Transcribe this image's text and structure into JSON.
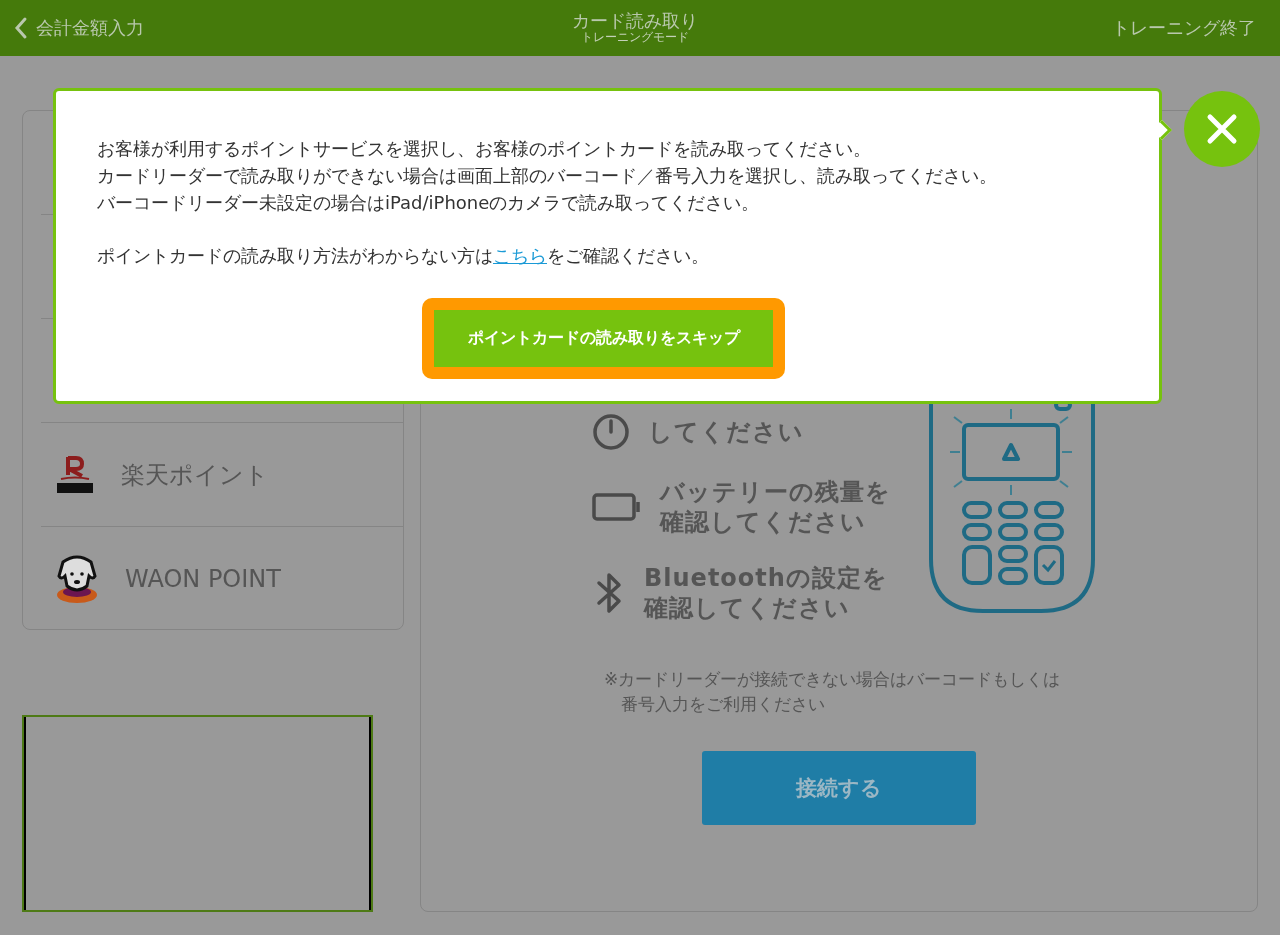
{
  "header": {
    "back_label": "会計金額入力",
    "title": "カード読み取り",
    "subtitle": "トレーニングモード",
    "end_label": "トレーニング終了"
  },
  "point_types": [
    {
      "kind": "rakuten",
      "name": "楽天ポイント"
    },
    {
      "kind": "waon",
      "name": "WAON POINT"
    }
  ],
  "instructions": [
    {
      "kind": "power",
      "lines": [
        "してください"
      ]
    },
    {
      "kind": "battery",
      "lines": [
        "バッテリーの残量を",
        "確認してください"
      ]
    },
    {
      "kind": "bluetooth",
      "lines": [
        "Bluetoothの設定を",
        "確認してください"
      ]
    }
  ],
  "note_lines": [
    "※カードリーダーが接続できない場合はバーコードもしくは",
    "番号入力をご利用ください"
  ],
  "connect_button": "接続する",
  "dialog": {
    "message_lines": [
      "お客様が利用するポイントサービスを選択し、お客様のポイントカードを読み取ってください。",
      "カードリーダーで読み取りができない場合は画面上部のバーコード／番号入力を選択し、読み取ってください。",
      "バーコードリーダー未設定の場合はiPad/iPhoneのカメラで読み取ってください。"
    ],
    "help_before": "ポイントカードの読み取り方法がわからない方は",
    "help_link": "こちら",
    "help_after": "をご確認ください。",
    "skip_button": "ポイントカードの読み取りをスキップ"
  }
}
